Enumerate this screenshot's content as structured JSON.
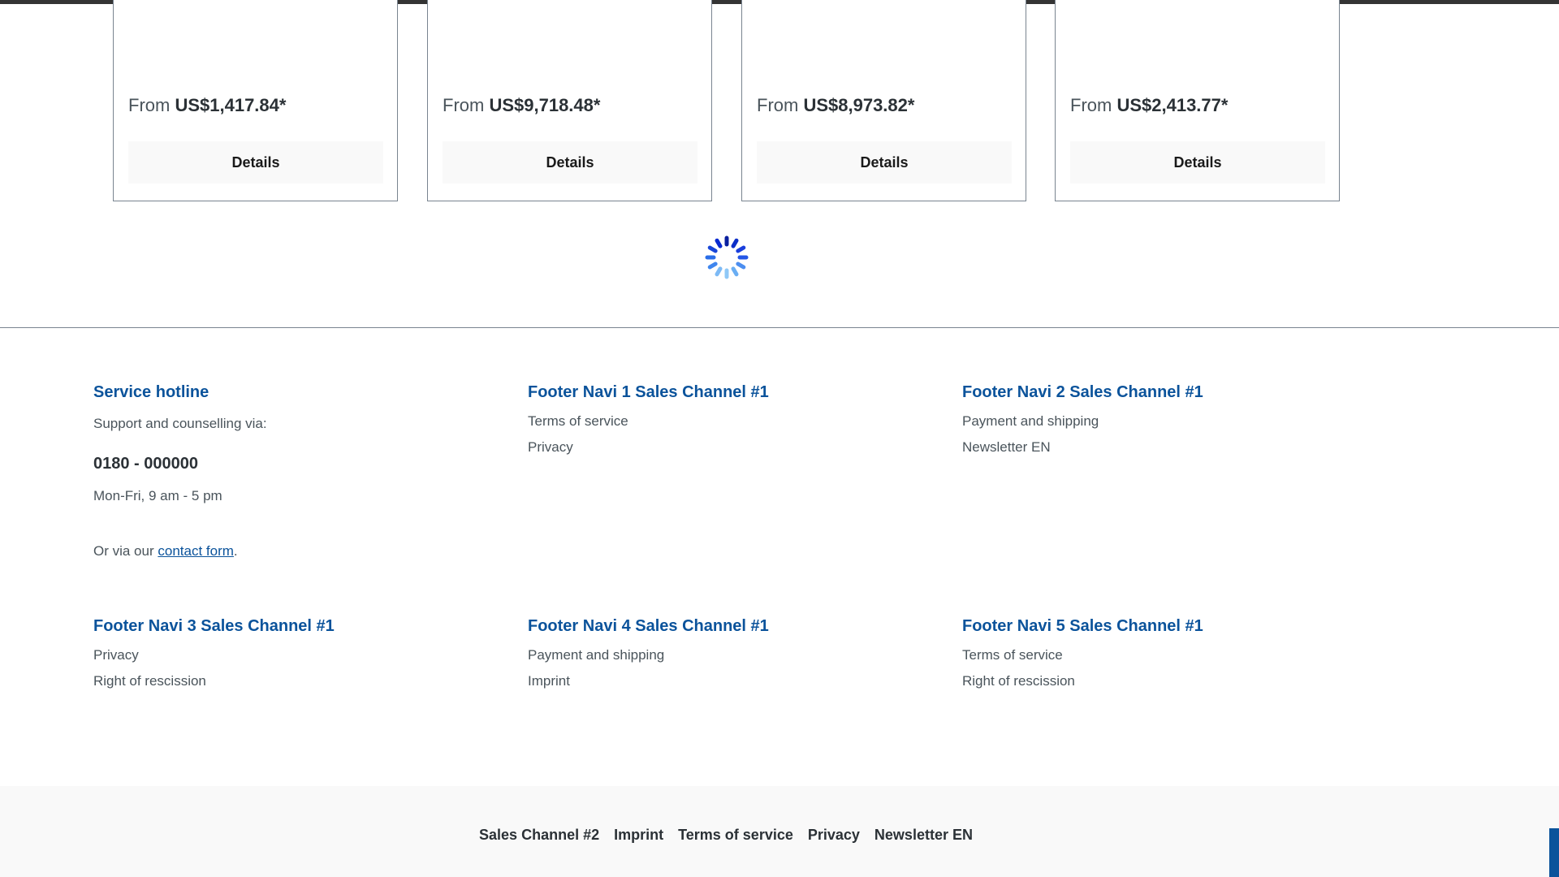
{
  "products": [
    {
      "price_prefix": "From",
      "price": "US$1,417.84*",
      "button_label": "Details"
    },
    {
      "price_prefix": "From",
      "price": "US$9,718.48*",
      "button_label": "Details"
    },
    {
      "price_prefix": "From",
      "price": "US$8,973.82*",
      "button_label": "Details"
    },
    {
      "price_prefix": "From",
      "price": "US$2,413.77*",
      "button_label": "Details"
    }
  ],
  "service": {
    "title": "Service hotline",
    "support_text": "Support and counselling via:",
    "phone": "0180 - 000000",
    "hours": "Mon-Fri, 9 am - 5 pm",
    "contact_prefix": "Or via our",
    "contact_link": "contact form",
    "contact_suffix": "."
  },
  "footer_navs": [
    {
      "title": "Footer Navi 1 Sales Channel #1",
      "links": [
        "Terms of service",
        "Privacy"
      ]
    },
    {
      "title": "Footer Navi 2 Sales Channel #1",
      "links": [
        "Payment and shipping",
        "Newsletter EN"
      ]
    },
    {
      "title": "Footer Navi 3 Sales Channel #1",
      "links": [
        "Privacy",
        "Right of rescission"
      ]
    },
    {
      "title": "Footer Navi 4 Sales Channel #1",
      "links": [
        "Payment and shipping",
        "Imprint"
      ]
    },
    {
      "title": "Footer Navi 5 Sales Channel #1",
      "links": [
        "Terms of service",
        "Right of rescission"
      ]
    }
  ],
  "bottom_nav": [
    "Sales Channel #2",
    "Imprint",
    "Terms of service",
    "Privacy",
    "Newsletter EN"
  ],
  "colors": {
    "accent": "#0b539b",
    "text": "#4a545b",
    "button_bg": "#f9f9f9",
    "spinner_dark": "#0a2bd1",
    "spinner_light": "#8fc8f7"
  },
  "icons": {
    "loading": "spinner-icon",
    "scroll_top": "scroll-to-top-button"
  }
}
